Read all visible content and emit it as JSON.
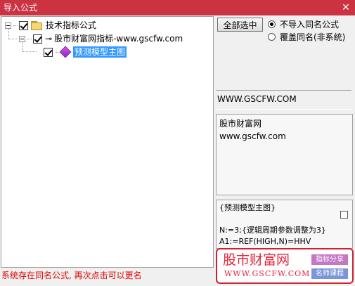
{
  "window": {
    "title": "导入公式",
    "close_glyph": "✕"
  },
  "tree": {
    "root": {
      "label": "技术指标公式",
      "checked": true,
      "expanded": true
    },
    "child": {
      "label": "股市财富网指标-www.gscfw.com",
      "checked": true,
      "expanded": true
    },
    "leaf": {
      "label": "预测模型主图",
      "checked": true,
      "selected": true
    }
  },
  "options": {
    "select_all_label": "全部选中",
    "radio_no_import": "不导入同名公式",
    "radio_overwrite": "覆盖同名(非系统)",
    "selected": "no_import"
  },
  "website": "WWW.GSCFW.COM",
  "info": {
    "line1": "股市财富网",
    "line2": "www.gscfw.com"
  },
  "code": {
    "line1": "{预测模型主图}",
    "line2": "",
    "line3": "N:=3;{逻辑周期参数调整为3}",
    "line4": "A1:=REF(HIGH,N)=HHV"
  },
  "status": "系统存在同名公式, 再次点击可以更名",
  "watermark": {
    "name": "股市财富网",
    "url": "WWW.GSCFW.COM",
    "tag1": "指标分享",
    "tag2": "名师课程"
  },
  "colors": {
    "titlebar": "#cc3340",
    "selection": "#3399ff",
    "status_text": "#e00000",
    "logo_red": "#e8233a"
  }
}
